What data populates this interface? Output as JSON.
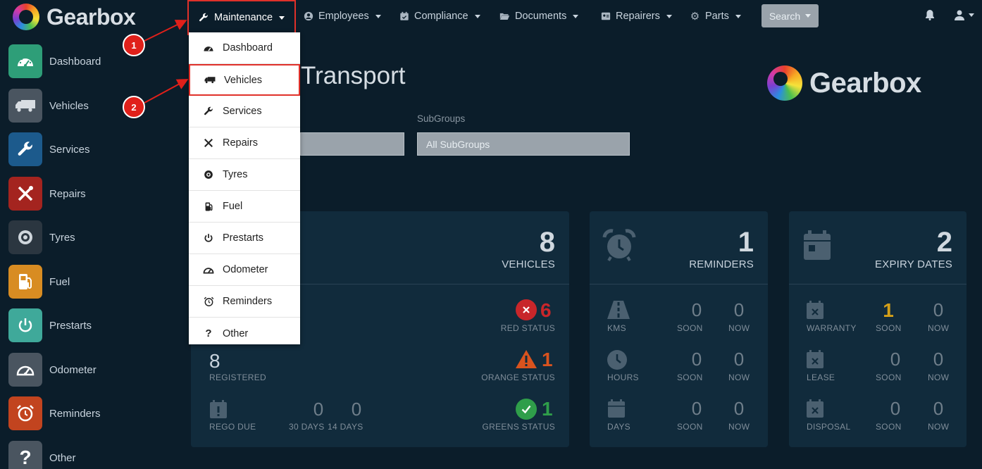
{
  "brand": {
    "name": "Gearbox"
  },
  "nav": {
    "maintenance": "Maintenance",
    "employees": "Employees",
    "compliance": "Compliance",
    "documents": "Documents",
    "repairers": "Repairers",
    "parts": "Parts",
    "search": "Search"
  },
  "sidebar": {
    "items": [
      {
        "label": "Dashboard",
        "icon": "dashboard-icon",
        "color": "#2e9e78"
      },
      {
        "label": "Vehicles",
        "icon": "truck-icon",
        "color": "#4a5560"
      },
      {
        "label": "Services",
        "icon": "wrench-icon",
        "color": "#1c5a8c"
      },
      {
        "label": "Repairs",
        "icon": "tools-icon",
        "color": "#a4241f"
      },
      {
        "label": "Tyres",
        "icon": "tyre-icon",
        "color": "#2b3640"
      },
      {
        "label": "Fuel",
        "icon": "fuel-icon",
        "color": "#d88c22"
      },
      {
        "label": "Prestarts",
        "icon": "power-icon",
        "color": "#3fa99a"
      },
      {
        "label": "Odometer",
        "icon": "odometer-icon",
        "color": "#4a5560"
      },
      {
        "label": "Reminders",
        "icon": "alarm-icon",
        "color": "#c2441f"
      },
      {
        "label": "Other",
        "icon": "question-icon",
        "color": "#4a5560"
      }
    ]
  },
  "dropdown": {
    "items": [
      {
        "label": "Dashboard",
        "icon": "dashboard-icon"
      },
      {
        "label": "Vehicles",
        "icon": "truck-icon"
      },
      {
        "label": "Services",
        "icon": "wrench-icon"
      },
      {
        "label": "Repairs",
        "icon": "tools-icon"
      },
      {
        "label": "Tyres",
        "icon": "tyre-icon"
      },
      {
        "label": "Fuel",
        "icon": "fuel-icon"
      },
      {
        "label": "Prestarts",
        "icon": "power-icon"
      },
      {
        "label": "Odometer",
        "icon": "odometer-icon"
      },
      {
        "label": "Reminders",
        "icon": "alarm-icon"
      },
      {
        "label": "Other",
        "icon": "question-icon"
      }
    ]
  },
  "annotations": {
    "one": "1",
    "two": "2"
  },
  "main": {
    "heading": "Transport",
    "subgroups_label": "SubGroups",
    "subgroups_value": "All SubGroups"
  },
  "vehicles_panel": {
    "count": "8",
    "count_label": "VEHICLES",
    "red": {
      "value": "6",
      "label": "RED STATUS"
    },
    "orange": {
      "value": "1",
      "label": "ORANGE STATUS"
    },
    "green": {
      "value": "1",
      "label": "GREENS STATUS"
    },
    "registered": {
      "value": "8",
      "label": "REGISTERED"
    },
    "rego_due": {
      "label": "REGO DUE",
      "d30": "0",
      "d30_label": "30 DAYS",
      "d14": "0",
      "d14_label": "14 DAYS"
    }
  },
  "reminders_panel": {
    "count": "1",
    "count_label": "REMINDERS",
    "rows": [
      {
        "label": "KMS",
        "soon": "0",
        "now": "0"
      },
      {
        "label": "HOURS",
        "soon": "0",
        "now": "0"
      },
      {
        "label": "DAYS",
        "soon": "0",
        "now": "0"
      }
    ],
    "soon_label": "SOON",
    "now_label": "NOW"
  },
  "expiry_panel": {
    "count": "2",
    "count_label": "EXPIRY DATES",
    "rows": [
      {
        "label": "WARRANTY",
        "soon": "1",
        "now": "0"
      },
      {
        "label": "LEASE",
        "soon": "0",
        "now": "0"
      },
      {
        "label": "DISPOSAL",
        "soon": "0",
        "now": "0"
      }
    ],
    "soon_label": "SOON",
    "now_label": "NOW"
  },
  "colors": {
    "accent_red": "#e0312a",
    "status_red": "#c8262a",
    "status_orange": "#d9531e",
    "status_green": "#2f9e4a",
    "soon_yellow": "#d4a019"
  }
}
